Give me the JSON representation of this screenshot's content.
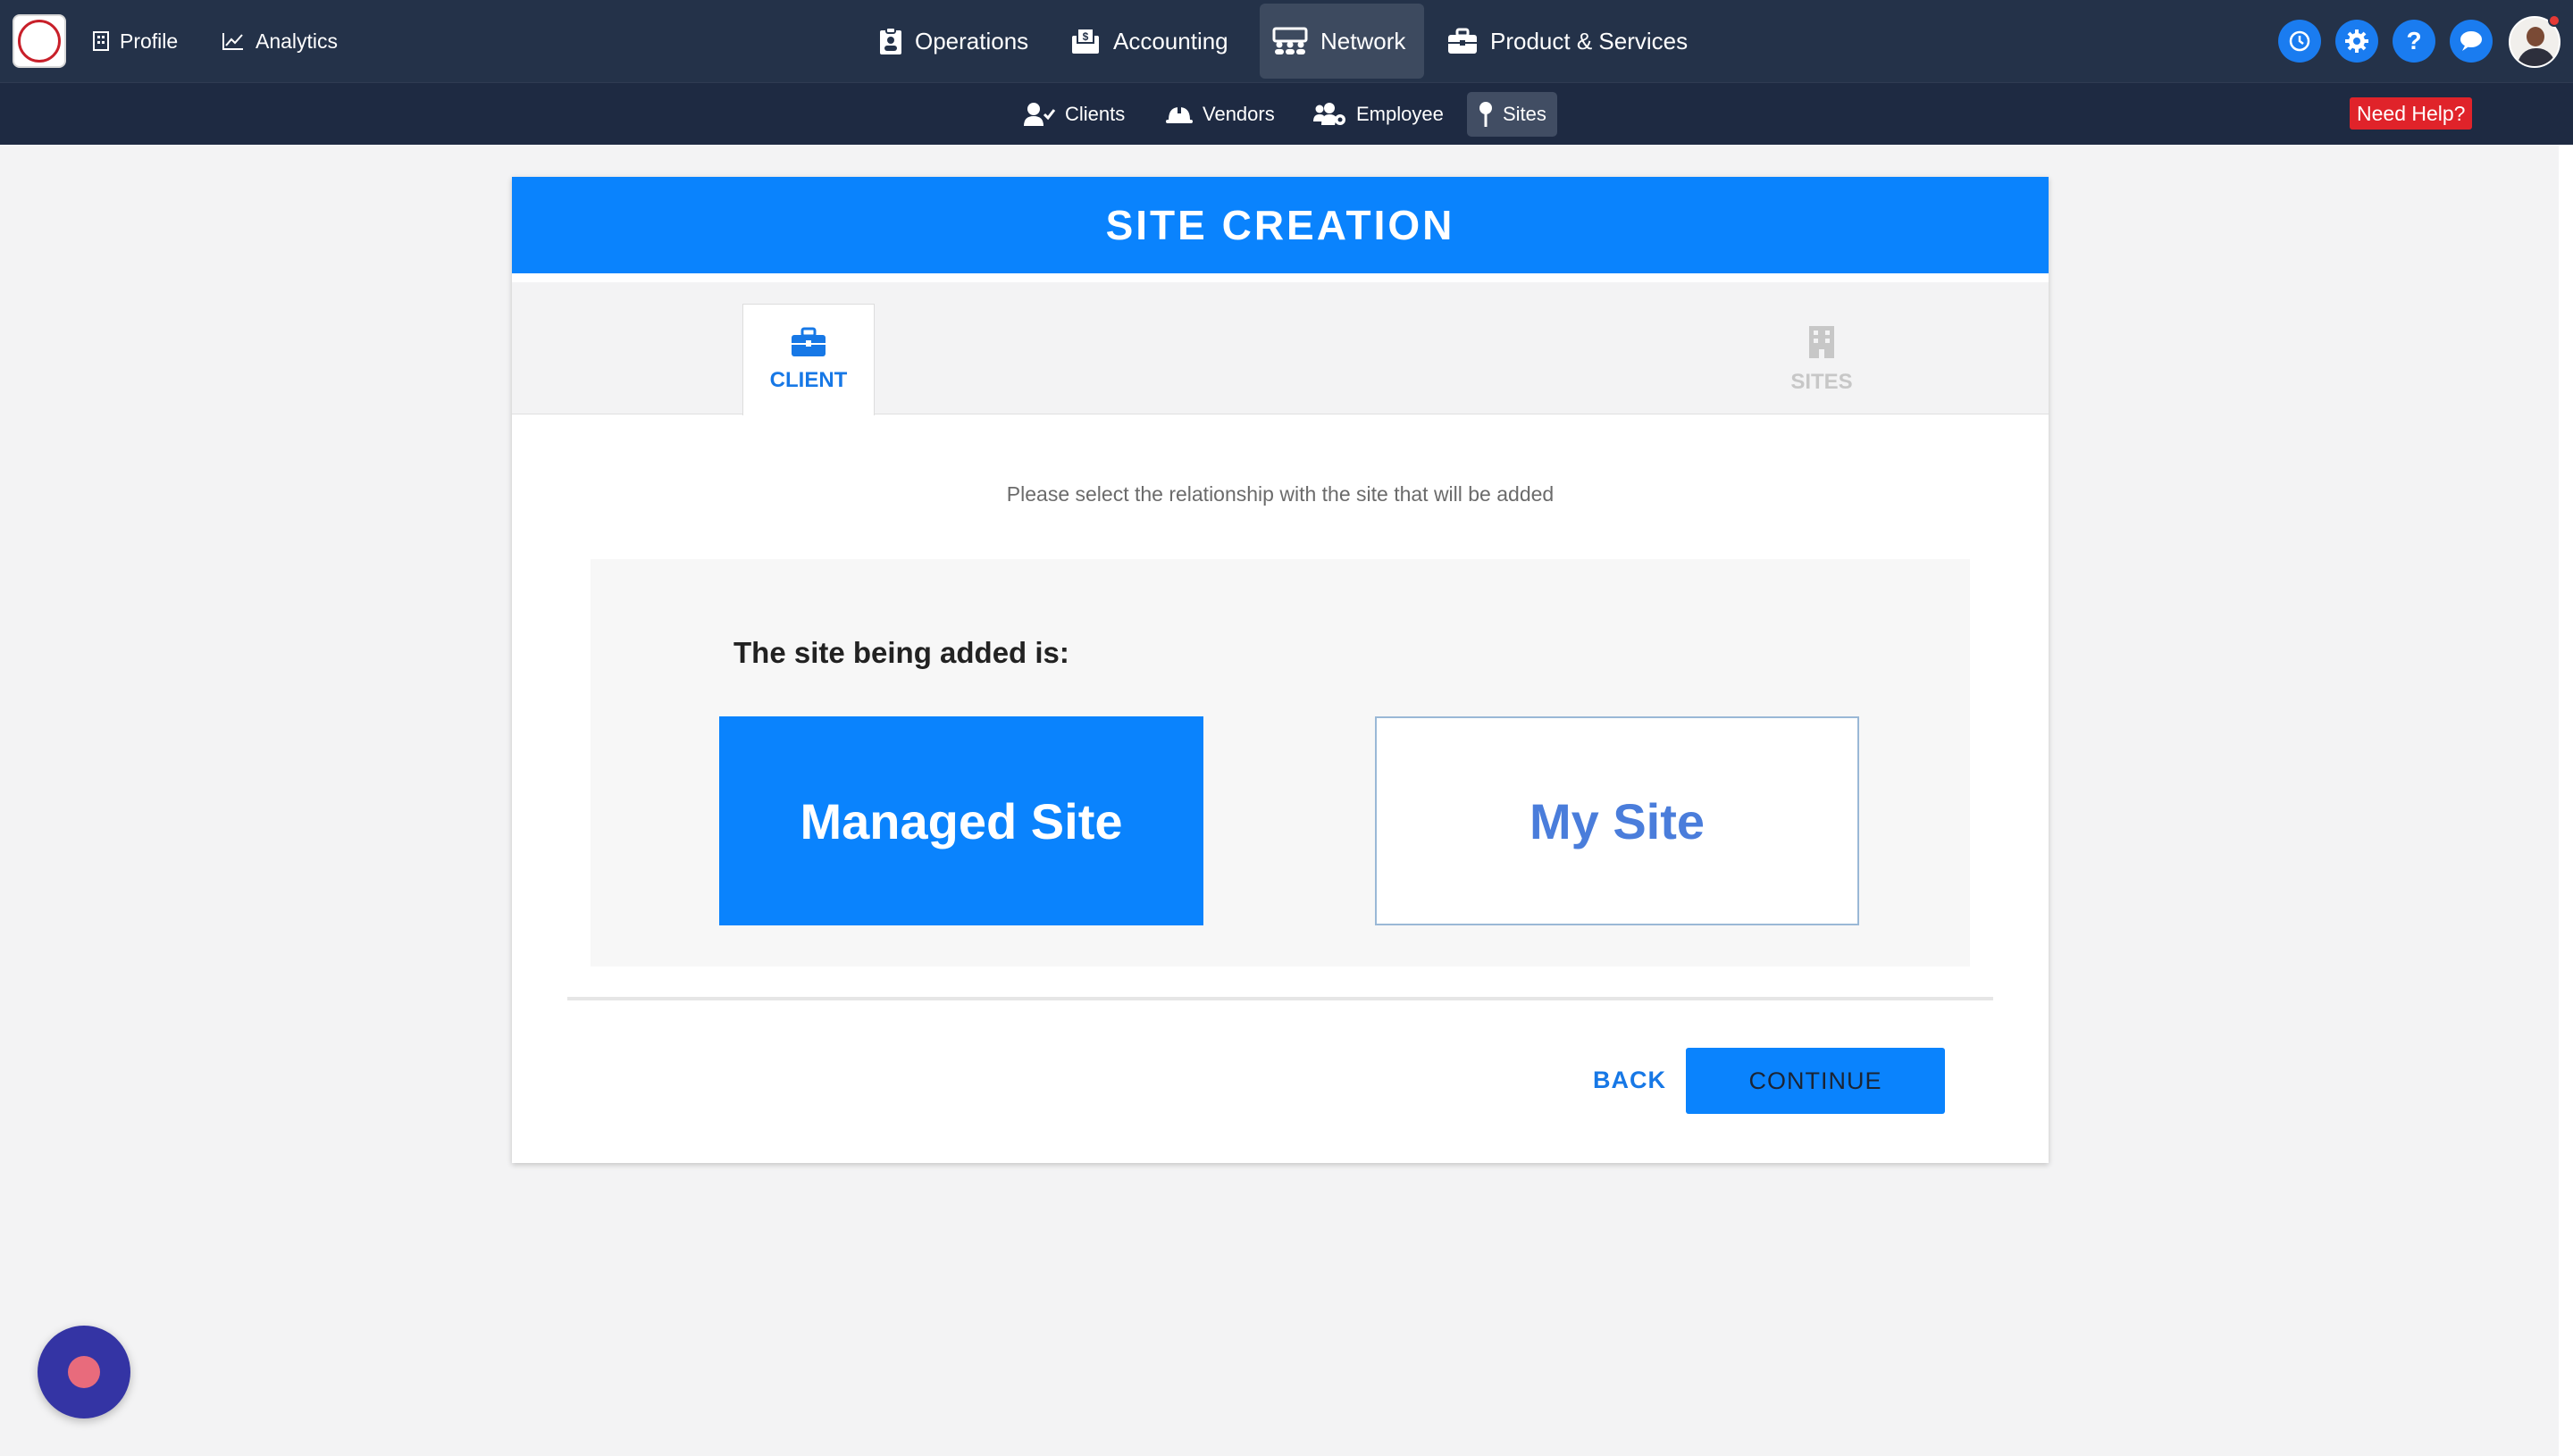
{
  "topnav": {
    "left_links": [
      {
        "label": "Profile",
        "icon": "building-icon"
      },
      {
        "label": "Analytics",
        "icon": "chart-line-icon"
      }
    ],
    "main_links": [
      {
        "label": "Operations",
        "icon": "clipboard-icon"
      },
      {
        "label": "Accounting",
        "icon": "money-box-icon"
      },
      {
        "label": "Network",
        "icon": "network-people-icon",
        "active": true
      },
      {
        "label": "Product & Services",
        "icon": "briefcase-icon"
      }
    ],
    "help_symbol": "?"
  },
  "subnav": {
    "links": [
      {
        "label": "Clients",
        "icon": "user-check-icon"
      },
      {
        "label": "Vendors",
        "icon": "hard-hat-icon"
      },
      {
        "label": "Employee",
        "icon": "users-cog-icon"
      },
      {
        "label": "Sites",
        "icon": "map-pin-icon",
        "active": true
      }
    ],
    "need_help": "Need Help?"
  },
  "card": {
    "title": "SITE CREATION",
    "steps": [
      {
        "label": "CLIENT",
        "icon": "briefcase-icon",
        "active": true
      },
      {
        "label": "SITES",
        "icon": "building-icon",
        "active": false
      }
    ],
    "instruction": "Please select the relationship with the site that will be added",
    "choice_label": "The site being added is:",
    "choices": [
      {
        "label": "Managed Site",
        "selected": true
      },
      {
        "label": "My Site",
        "selected": false
      }
    ],
    "back_label": "BACK",
    "continue_label": "CONTINUE"
  },
  "colors": {
    "topbar": "#243249",
    "subbar": "#1e2a42",
    "accent": "#0a83fd",
    "need_help": "#e0232a",
    "fab": "#3434a4"
  }
}
